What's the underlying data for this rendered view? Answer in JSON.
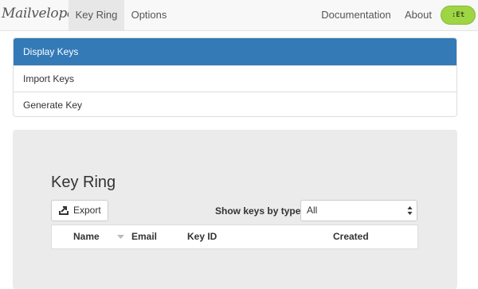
{
  "navbar": {
    "brand": "Mailvelope",
    "tabs": [
      {
        "label": "Key Ring",
        "active": true
      },
      {
        "label": "Options",
        "active": false
      }
    ],
    "right_links": [
      {
        "label": "Documentation"
      },
      {
        "label": "About"
      }
    ],
    "extension_badge": ":Et",
    "badge_color": "#9ed545"
  },
  "subnav": {
    "items": [
      {
        "label": "Display Keys",
        "active": true
      },
      {
        "label": "Import Keys",
        "active": false
      },
      {
        "label": "Generate Key",
        "active": false
      }
    ],
    "active_color": "#337ab7"
  },
  "main": {
    "title": "Key Ring",
    "export_button": {
      "label": "Export",
      "icon": "export-icon"
    },
    "filter": {
      "label": "Show keys by type",
      "selected": "All"
    },
    "table": {
      "columns": [
        {
          "label": "Name",
          "sortable": true,
          "sort_icon": "sort-down-icon"
        },
        {
          "label": "Email"
        },
        {
          "label": "Key ID"
        },
        {
          "label": "Created"
        }
      ],
      "rows": []
    }
  }
}
